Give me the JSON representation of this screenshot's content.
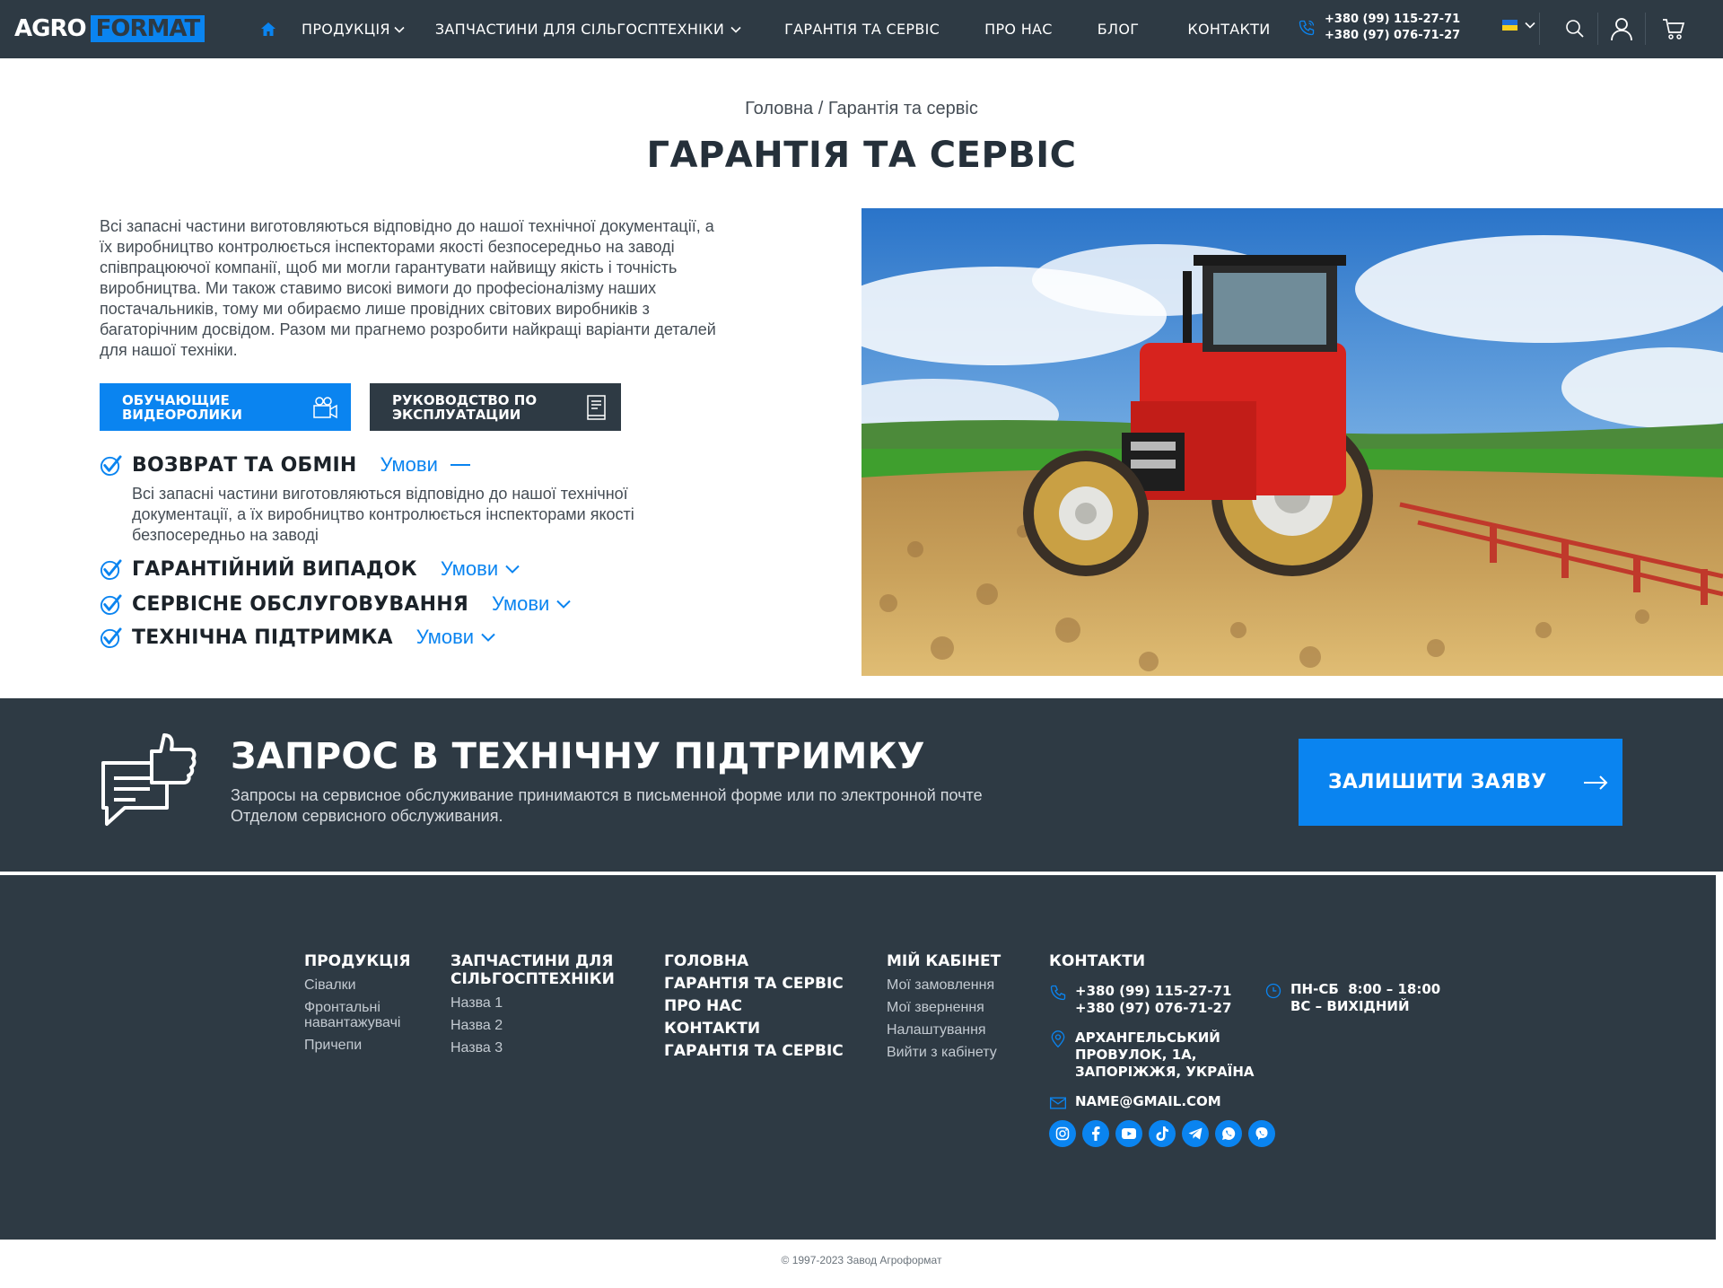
{
  "brand": {
    "part1": "AGRO",
    "part2": "FORMAT"
  },
  "colors": {
    "accent": "#0a84f0",
    "dark": "#2e3a44",
    "text": "#25303a"
  },
  "nav": {
    "items": [
      {
        "label": "ПРОДУКЦІЯ",
        "dropdown": true
      },
      {
        "label": "ЗАПЧАСТИНИ ДЛЯ СІЛЬГОСПТЕХНІКИ",
        "dropdown": true
      },
      {
        "label": "ГАРАНТІЯ ТА СЕРВІС",
        "dropdown": false
      },
      {
        "label": "ПРО НАС",
        "dropdown": false
      },
      {
        "label": "БЛОГ",
        "dropdown": false
      },
      {
        "label": "КОНТАКТИ",
        "dropdown": false
      }
    ],
    "phone1": "+380 (99) 115-27-71",
    "phone2": "+380 (97) 076-71-27",
    "language": "ua-flag"
  },
  "breadcrumb": {
    "home": "Головна",
    "separator": " / ",
    "current": "Гарантія та сервіс"
  },
  "page_title": "ГАРАНТІЯ ТА СЕРВІС",
  "intro": "Всі запасні частини виготовляються відповідно до нашої технічної документації, а їх виробництво контролюється інспекторами якості безпосередньо на заводі співпрацюючої компанії, щоб ми могли гарантувати найвищу якість і точність виробництва. Ми також ставимо високі вимоги до професіоналізму наших постачальників, тому ми обираємо лише провідних світових виробників з багаторічним досвідом. Разом ми прагнемо розробити найкращі варіанти деталей для нашої техніки.",
  "buttons": {
    "videos_line1": "ОБУЧАЮЩИЕ",
    "videos_line2": "ВИДЕОРОЛИКИ",
    "manual_line1": "РУКОВОДСТВО ПО",
    "manual_line2": "ЭКСПЛУАТАЦИИ"
  },
  "accordion": [
    {
      "title": "ВОЗВРАТ ТА ОБМІН",
      "link": "Умови",
      "expanded": true,
      "body": "Всі запасні частини виготовляються відповідно до нашої технічної документації, а їх виробництво контролюється інспекторами якості безпосередньо на заводі"
    },
    {
      "title": "ГАРАНТІЙНИЙ ВИПАДОК",
      "link": "Умови",
      "expanded": false
    },
    {
      "title": "СЕРВІСНЕ ОБСЛУГОВУВАННЯ",
      "link": "Умови",
      "expanded": false
    },
    {
      "title": "ТЕХНІЧНА ПІДТРИМКА",
      "link": "Умови",
      "expanded": false
    }
  ],
  "cta": {
    "title": "ЗАПРОС В ТЕХНІЧНУ ПІДТРИМКУ",
    "text": "Запросы на сервисное обслуживание принимаются в письменной форме или по электронной почте Отделом сервисного обслуживания.",
    "button": "ЗАЛИШИТИ ЗАЯВУ"
  },
  "footer": {
    "products": {
      "title": "ПРОДУКЦІЯ",
      "links": [
        "Сівалки",
        "Фронтальні навантажувачі",
        "Причепи"
      ]
    },
    "parts": {
      "title_line1": "ЗАПЧАСТИНИ ДЛЯ",
      "title_line2": "СІЛЬГОСПТЕХНІКИ",
      "links": [
        "Назва 1",
        "Назва 2",
        "Назва 3"
      ]
    },
    "main_links": [
      "ГОЛОВНА",
      "ГАРАНТІЯ ТА СЕРВІС",
      "ПРО НАС",
      "КОНТАКТИ",
      "ГАРАНТІЯ ТА СЕРВІС"
    ],
    "cabinet": {
      "title": "МІЙ КАБІНЕТ",
      "links": [
        "Мої замовлення",
        "Мої звернення",
        "Налаштування",
        "Вийти з кабінету"
      ]
    },
    "contacts": {
      "title": "КОНТАКТИ",
      "phone1": "+380 (99) 115-27-71",
      "phone2": "+380 (97) 076-71-27",
      "address_line1": "АРХАНГЕЛЬСЬКИЙ",
      "address_line2": "ПРОВУЛОК, 1А,",
      "address_line3": "ЗАПОРІЖЖЯ, УКРАЇНА",
      "email": "NAME@GMAIL.COM",
      "hours1": "ПН-СБ  8:00 – 18:00",
      "hours2": "ВС – ВИХІДНИЙ"
    },
    "socials": [
      "instagram-icon",
      "facebook-icon",
      "youtube-icon",
      "tiktok-icon",
      "telegram-icon",
      "whatsapp-icon",
      "viber-icon"
    ],
    "copyright": "© 1997-2023 Завод Агроформат"
  }
}
